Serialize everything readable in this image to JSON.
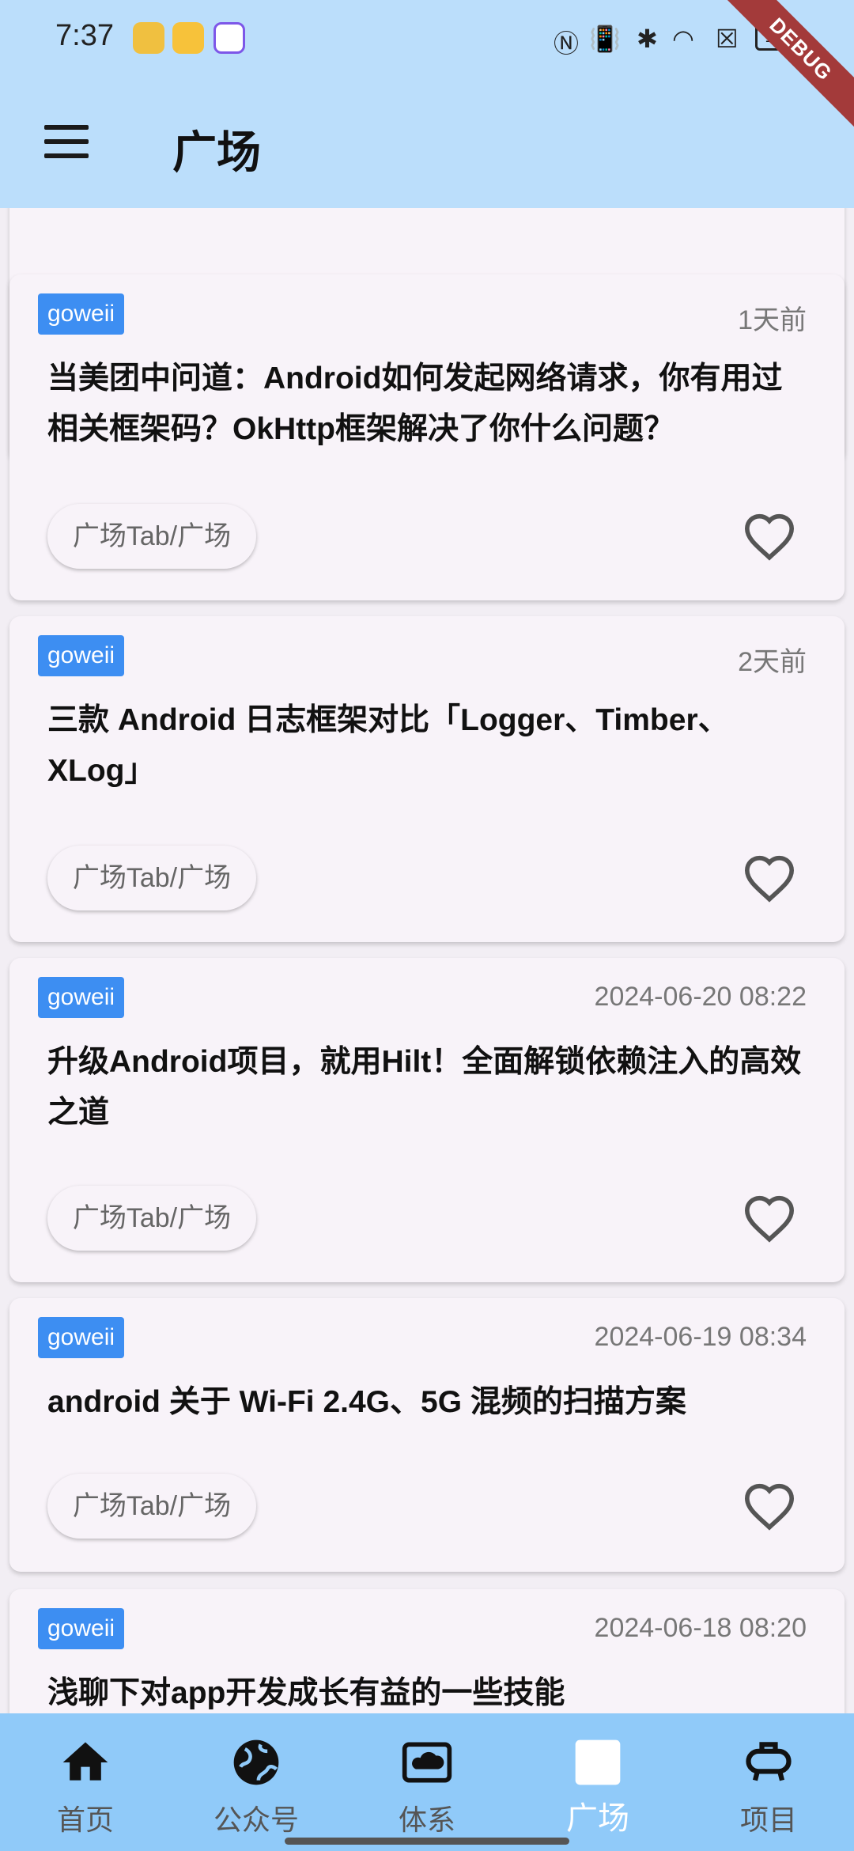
{
  "status": {
    "time": "7:37",
    "battery": "100",
    "debug": "DEBUG"
  },
  "appbar": {
    "title": "广场"
  },
  "cards": [
    {
      "author": "goweii",
      "time": "1天前",
      "title": "当美团中问道：Android如何发起网络请求，你有用过相关框架码？OkHttp框架解决了你什么问题？",
      "chip": "广场Tab/广场"
    },
    {
      "author": "goweii",
      "time": "2天前",
      "title": "三款 Android 日志框架对比「Logger、Timber、XLog」",
      "chip": "广场Tab/广场"
    },
    {
      "author": "goweii",
      "time": "2024-06-20 08:22",
      "title": "升级Android项目，就用Hilt！全面解锁依赖注入的高效之道",
      "chip": "广场Tab/广场"
    },
    {
      "author": "goweii",
      "time": "2024-06-19 08:34",
      "title": "android 关于 Wi-Fi 2.4G、5G 混频的扫描方案",
      "chip": "广场Tab/广场"
    },
    {
      "author": "goweii",
      "time": "2024-06-18 08:20",
      "title": "浅聊下对app开发成长有益的一些技能",
      "chip": ""
    }
  ],
  "tabs": [
    {
      "label": "首页",
      "icon": "home-icon"
    },
    {
      "label": "公众号",
      "icon": "globe-icon"
    },
    {
      "label": "体系",
      "icon": "cloud-screen-icon"
    },
    {
      "label": "广场",
      "icon": "square-icon",
      "active": true
    },
    {
      "label": "项目",
      "icon": "briefcase-icon"
    }
  ]
}
